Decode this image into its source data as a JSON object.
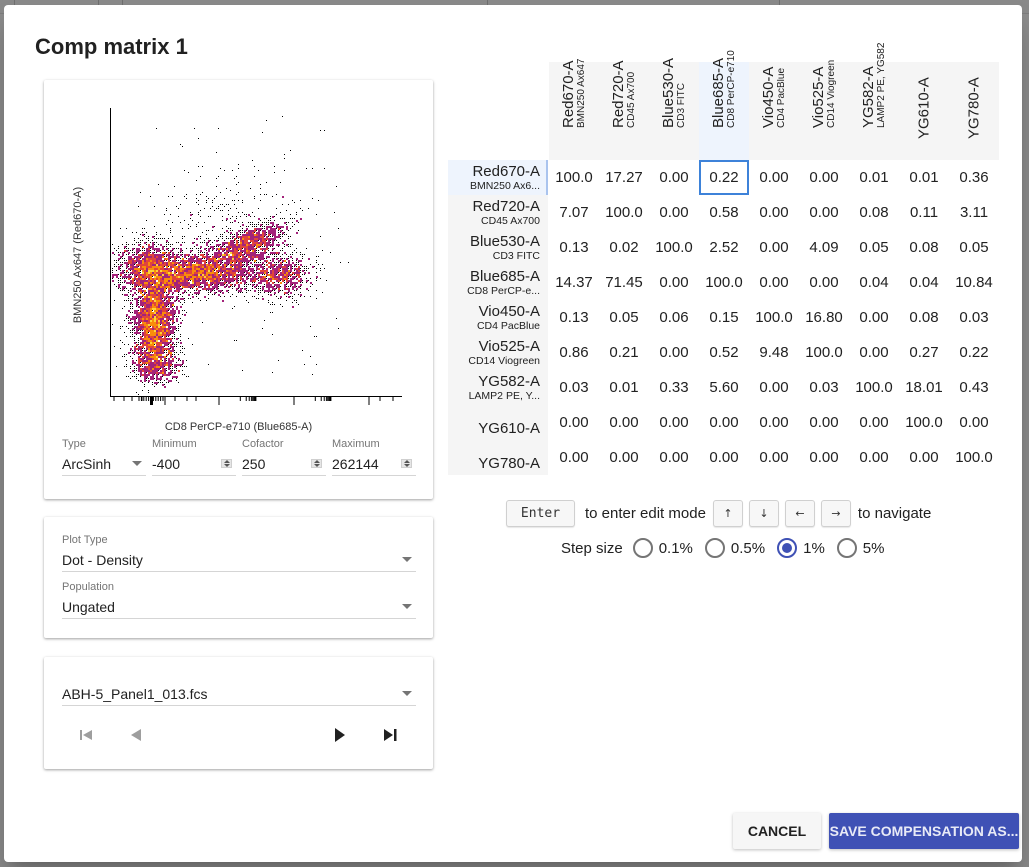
{
  "dialog": {
    "title": "Comp matrix 1"
  },
  "plot": {
    "type": "density-dot",
    "x_label": "CD8 PerCP-e710 (Blue685-A)",
    "y_label": "BMN250 Ax647 (Red670-A)",
    "colormap": [
      "#000000",
      "#2a0b4d",
      "#5c1487",
      "#a3237a",
      "#e0453b",
      "#f98c0a",
      "#fbd43a",
      "#fcffa4"
    ]
  },
  "scale": {
    "type_label": "Type",
    "type_value": "ArcSinh",
    "min_label": "Minimum",
    "min_value": "-400",
    "cofactor_label": "Cofactor",
    "cofactor_value": "250",
    "max_label": "Maximum",
    "max_value": "262144"
  },
  "options": {
    "plot_type_label": "Plot Type",
    "plot_type_value": "Dot - Density",
    "population_label": "Population",
    "population_value": "Ungated"
  },
  "file": {
    "selected": "ABH-5_Panel1_013.fcs",
    "nav": {
      "first": "first-file",
      "prev": "previous-file",
      "next": "next-file",
      "last": "last-file"
    }
  },
  "matrix": {
    "columns": [
      {
        "channel": "Red670-A",
        "marker": "BMN250 Ax647"
      },
      {
        "channel": "Red720-A",
        "marker": "CD45 Ax700"
      },
      {
        "channel": "Blue530-A",
        "marker": "CD3 FITC"
      },
      {
        "channel": "Blue685-A",
        "marker": "CD8 PerCP-e710"
      },
      {
        "channel": "Vio450-A",
        "marker": "CD4 PacBlue"
      },
      {
        "channel": "Vio525-A",
        "marker": "CD14 Viogreen"
      },
      {
        "channel": "YG582-A",
        "marker": "LAMP2 PE, YG582"
      },
      {
        "channel": "YG610-A",
        "marker": ""
      },
      {
        "channel": "YG780-A",
        "marker": ""
      }
    ],
    "rows": [
      {
        "channel": "Red670-A",
        "marker": "BMN250 Ax6...",
        "values": [
          "100.0",
          "17.27",
          "0.00",
          "0.22",
          "0.00",
          "0.00",
          "0.01",
          "0.01",
          "0.36"
        ]
      },
      {
        "channel": "Red720-A",
        "marker": "CD45 Ax700",
        "values": [
          "7.07",
          "100.0",
          "0.00",
          "0.58",
          "0.00",
          "0.00",
          "0.08",
          "0.11",
          "3.11"
        ]
      },
      {
        "channel": "Blue530-A",
        "marker": "CD3 FITC",
        "values": [
          "0.13",
          "0.02",
          "100.0",
          "2.52",
          "0.00",
          "4.09",
          "0.05",
          "0.08",
          "0.05"
        ]
      },
      {
        "channel": "Blue685-A",
        "marker": "CD8 PerCP-e...",
        "values": [
          "14.37",
          "71.45",
          "0.00",
          "100.0",
          "0.00",
          "0.00",
          "0.04",
          "0.04",
          "10.84"
        ]
      },
      {
        "channel": "Vio450-A",
        "marker": "CD4 PacBlue",
        "values": [
          "0.13",
          "0.05",
          "0.06",
          "0.15",
          "100.0",
          "16.80",
          "0.00",
          "0.08",
          "0.03"
        ]
      },
      {
        "channel": "Vio525-A",
        "marker": "CD14 Viogreen",
        "values": [
          "0.86",
          "0.21",
          "0.00",
          "0.52",
          "9.48",
          "100.0",
          "0.00",
          "0.27",
          "0.22"
        ]
      },
      {
        "channel": "YG582-A",
        "marker": "LAMP2 PE, Y...",
        "values": [
          "0.03",
          "0.01",
          "0.33",
          "5.60",
          "0.00",
          "0.03",
          "100.0",
          "18.01",
          "0.43"
        ]
      },
      {
        "channel": "YG610-A",
        "marker": "",
        "values": [
          "0.00",
          "0.00",
          "0.00",
          "0.00",
          "0.00",
          "0.00",
          "0.00",
          "100.0",
          "0.00"
        ]
      },
      {
        "channel": "YG780-A",
        "marker": "",
        "values": [
          "0.00",
          "0.00",
          "0.00",
          "0.00",
          "0.00",
          "0.00",
          "0.00",
          "0.00",
          "100.0"
        ]
      }
    ],
    "selected_cell": {
      "row": 0,
      "col": 3
    }
  },
  "hints": {
    "enter_key": "Enter",
    "enter_text": "to enter edit mode",
    "arrow_keys": [
      "↑",
      "↓",
      "←",
      "→"
    ],
    "navigate_text": "to navigate",
    "step_label": "Step size",
    "step_options": [
      "0.1%",
      "0.5%",
      "1%",
      "5%"
    ],
    "step_selected": "1%"
  },
  "actions": {
    "cancel": "CANCEL",
    "save": "SAVE COMPENSATION AS..."
  },
  "colors": {
    "accent": "#3f51b5",
    "selection": "#3d82d9"
  }
}
